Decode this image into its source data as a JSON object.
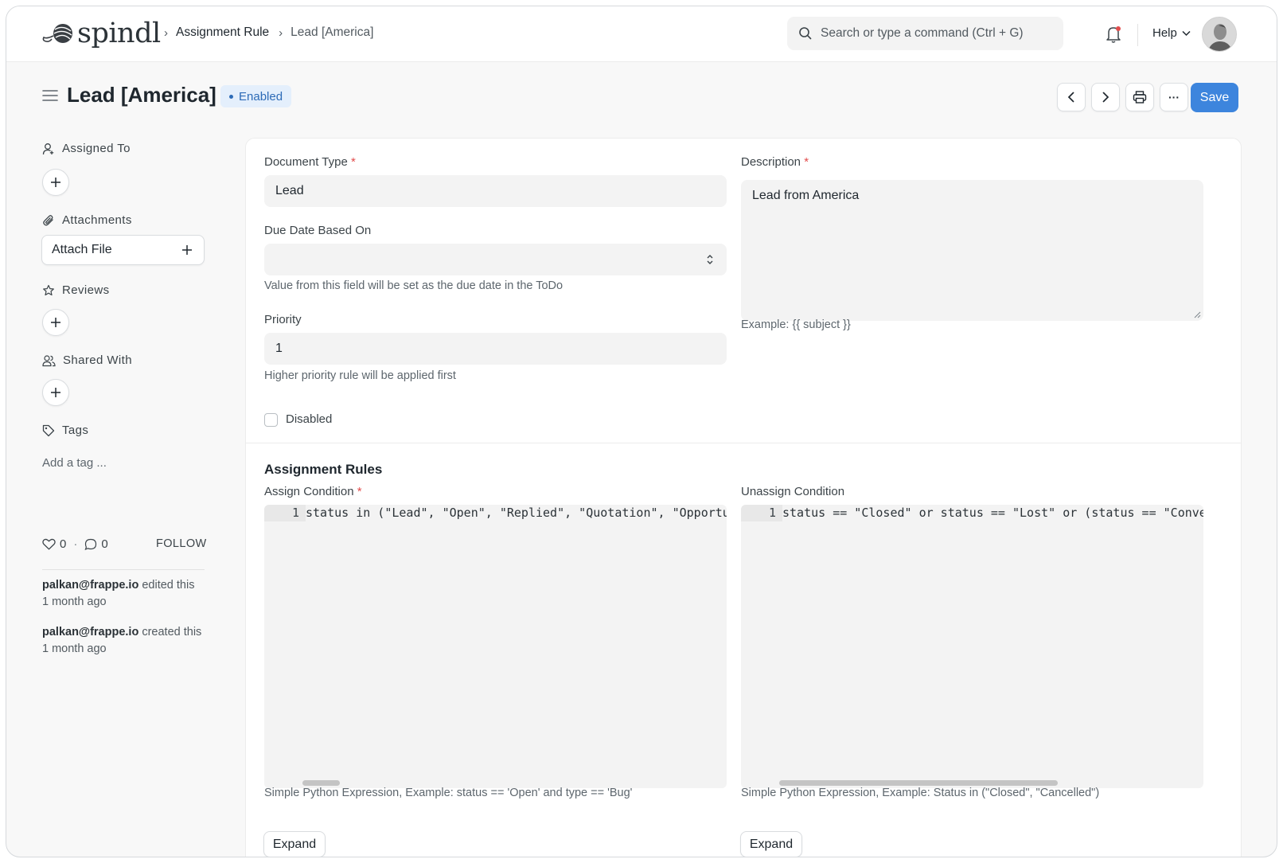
{
  "app": {
    "logo_text": "spindl"
  },
  "breadcrumbs": [
    {
      "label": "Assignment Rule"
    },
    {
      "label": "Lead [America]"
    }
  ],
  "search": {
    "placeholder": "Search or type a command (Ctrl + G)"
  },
  "navbar": {
    "help_label": "Help",
    "notification_icon": "bell-icon",
    "notification_color": "#e24c4c"
  },
  "page": {
    "title": "Lead [America]",
    "status_badge": "Enabled",
    "save_label": "Save",
    "more_label": "···"
  },
  "sidebar": {
    "assigned_to": "Assigned To",
    "attachments": "Attachments",
    "attach_file": "Attach File",
    "reviews": "Reviews",
    "shared_with": "Shared With",
    "tags": "Tags",
    "add_tag": "Add a tag ...",
    "likes": "0",
    "comments": "0",
    "follow": "FOLLOW",
    "activity": [
      {
        "user": "palkan@frappe.io",
        "action": " edited this",
        "time": "1 month ago"
      },
      {
        "user": "palkan@frappe.io",
        "action": " created this",
        "time": "1 month ago"
      }
    ]
  },
  "form": {
    "document_type": {
      "label": "Document Type",
      "required": "*",
      "value": "Lead"
    },
    "due_date": {
      "label": "Due Date Based On",
      "value": "",
      "help": "Value from this field will be set as the due date in the ToDo"
    },
    "priority": {
      "label": "Priority",
      "value": "1",
      "help": "Higher priority rule will be applied first"
    },
    "disabled": {
      "label": "Disabled",
      "checked": false
    },
    "description": {
      "label": "Description",
      "required": "*",
      "value": "Lead from America",
      "help": "Example: {{ subject }}"
    }
  },
  "assignment_rules": {
    "title": "Assignment Rules",
    "assign_condition": {
      "label": "Assign Condition",
      "required": "*",
      "line_number": "1",
      "code": "status in (\"Lead\", \"Open\", \"Replied\", \"Quotation\", \"Opportuni",
      "help": "Simple Python Expression, Example: status == 'Open' and type == 'Bug'",
      "expand_label": "Expand"
    },
    "unassign_condition": {
      "label": "Unassign Condition",
      "line_number": "1",
      "code": "status == \"Closed\" or status == \"Lost\" or (status == \"Convert",
      "help": "Simple Python Expression, Example: Status in (\"Closed\", \"Cancelled\")",
      "expand_label": "Expand"
    }
  },
  "colors": {
    "primary": "#3d85dd",
    "badge_bg": "#e4effc",
    "badge_text": "#2d6bb7",
    "required": "#e24c4c"
  }
}
